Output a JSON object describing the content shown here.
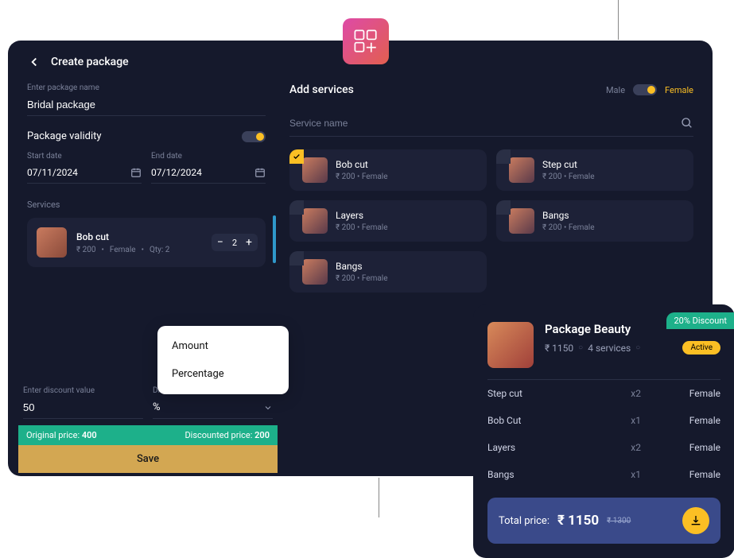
{
  "header": {
    "title": "Create package"
  },
  "form": {
    "pkg_name_label": "Enter package name",
    "pkg_name_value": "Bridal package",
    "validity_label": "Package validity",
    "start_date_label": "Start date",
    "start_date_value": "07/11/2024",
    "end_date_label": "End date",
    "end_date_value": "07/12/2024",
    "services_label": "Services"
  },
  "selected_service": {
    "name": "Bob cut",
    "price": "₹ 200",
    "gender": "Female",
    "qty_label": "Qty: 2",
    "qty": "2"
  },
  "right": {
    "title": "Add services",
    "male": "Male",
    "female": "Female",
    "search_placeholder": "Service name"
  },
  "services": [
    {
      "name": "Bob cut",
      "price": "₹ 200",
      "gender": "Female",
      "selected": true
    },
    {
      "name": "Step cut",
      "price": "₹ 200",
      "gender": "Female",
      "selected": false
    },
    {
      "name": "Layers",
      "price": "₹ 200",
      "gender": "Female",
      "selected": false
    },
    {
      "name": "Bangs",
      "price": "₹ 200",
      "gender": "Female",
      "selected": false
    },
    {
      "name": "Bangs",
      "price": "₹ 200",
      "gender": "Female",
      "selected": false
    }
  ],
  "dropdown": {
    "opt1": "Amount",
    "opt2": "Percentage"
  },
  "discount": {
    "value_label": "Enter discount value",
    "value": "50",
    "type_label": "Discount type",
    "type": "%"
  },
  "price_bar": {
    "original_label": "Original price:",
    "original": "400",
    "discounted_label": "Discounted price:",
    "discounted": "200"
  },
  "save_label": "Save",
  "package_card": {
    "ribbon": "20% Discount",
    "title": "Package Beauty",
    "price": "₹ 1150",
    "services_count": "4 services",
    "active": "Active",
    "lines": [
      {
        "name": "Step cut",
        "qty": "x2",
        "gender": "Female"
      },
      {
        "name": "Bob Cut",
        "qty": "x1",
        "gender": "Female"
      },
      {
        "name": "Layers",
        "qty": "x2",
        "gender": "Female"
      },
      {
        "name": "Bangs",
        "qty": "x1",
        "gender": "Female"
      }
    ],
    "total_label": "Total price:",
    "total": "₹ 1150",
    "total_orig": "₹ 1300"
  }
}
